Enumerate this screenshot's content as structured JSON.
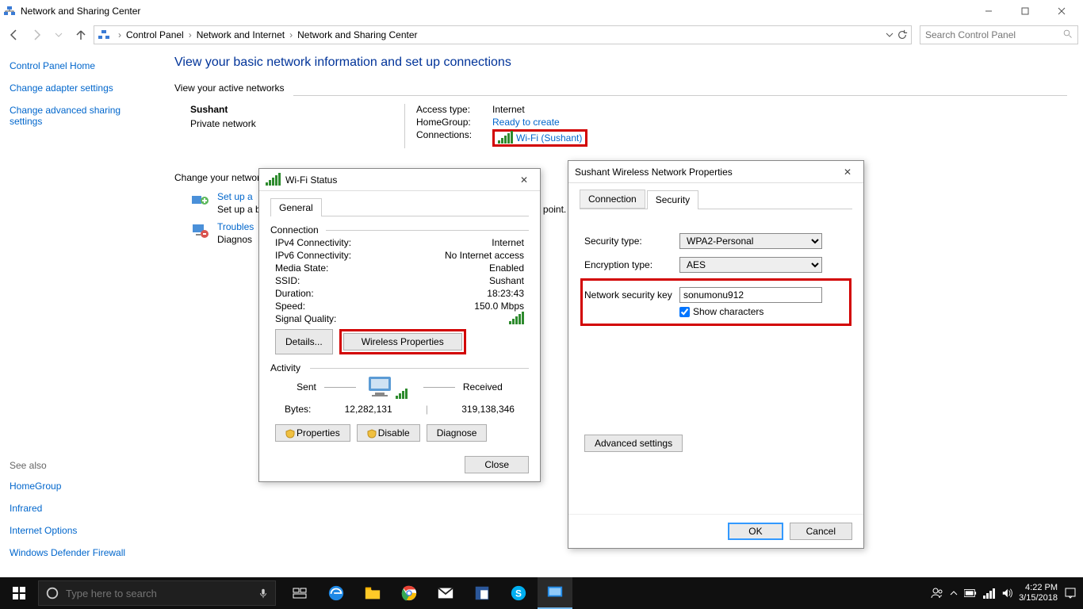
{
  "window": {
    "title": "Network and Sharing Center",
    "breadcrumb": [
      "Control Panel",
      "Network and Internet",
      "Network and Sharing Center"
    ],
    "search_placeholder": "Search Control Panel"
  },
  "sidebar": {
    "home": "Control Panel Home",
    "links": [
      "Change adapter settings",
      "Change advanced sharing settings"
    ],
    "see_also_hdr": "See also",
    "see_also": [
      "HomeGroup",
      "Infrared",
      "Internet Options",
      "Windows Defender Firewall"
    ]
  },
  "content": {
    "heading": "View your basic network information and set up connections",
    "active_hdr": "View your active networks",
    "network": {
      "name": "Sushant",
      "type": "Private network",
      "access_label": "Access type:",
      "access_value": "Internet",
      "homegroup_label": "HomeGroup:",
      "homegroup_value": "Ready to create",
      "connections_label": "Connections:",
      "connections_value": "Wi-Fi (Sushant)"
    },
    "change_hdr": "Change your networking settings",
    "setup": {
      "link": "Set up a",
      "sub": "Set up a"
    },
    "troubleshoot": {
      "link": "Troubles",
      "sub": "Diagnos"
    }
  },
  "wifi_dialog": {
    "title": "Wi-Fi Status",
    "tab_general": "General",
    "grp_connection": "Connection",
    "rows": {
      "ipv4": {
        "k": "IPv4 Connectivity:",
        "v": "Internet"
      },
      "ipv6": {
        "k": "IPv6 Connectivity:",
        "v": "No Internet access"
      },
      "media": {
        "k": "Media State:",
        "v": "Enabled"
      },
      "ssid": {
        "k": "SSID:",
        "v": "Sushant"
      },
      "duration": {
        "k": "Duration:",
        "v": "18:23:43"
      },
      "speed": {
        "k": "Speed:",
        "v": "150.0 Mbps"
      },
      "signal": {
        "k": "Signal Quality:"
      }
    },
    "btn_details": "Details...",
    "btn_wireless": "Wireless Properties",
    "grp_activity": "Activity",
    "sent": "Sent",
    "received": "Received",
    "bytes_label": "Bytes:",
    "bytes_sent": "12,282,131",
    "bytes_recv": "319,138,346",
    "btn_properties": "Properties",
    "btn_disable": "Disable",
    "btn_diagnose": "Diagnose",
    "btn_close": "Close"
  },
  "props_dialog": {
    "title": "Sushant Wireless Network Properties",
    "tab_connection": "Connection",
    "tab_security": "Security",
    "security_type_label": "Security type:",
    "security_type_value": "WPA2-Personal",
    "encryption_label": "Encryption type:",
    "encryption_value": "AES",
    "key_label": "Network security key",
    "key_value": "sonumonu912",
    "show_chars": "Show characters",
    "btn_advanced": "Advanced settings",
    "btn_ok": "OK",
    "btn_cancel": "Cancel"
  },
  "taskbar": {
    "search_placeholder": "Type here to search",
    "time": "4:22 PM",
    "date": "3/15/2018"
  }
}
